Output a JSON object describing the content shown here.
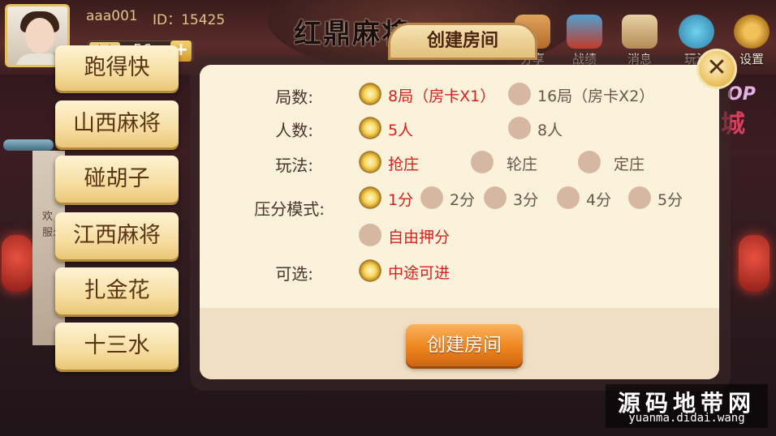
{
  "header": {
    "username": "aaa001",
    "user_id": "ID：15425",
    "card_label": "房卡",
    "card_count": "56",
    "card_add": "+",
    "logo_text": "红鼎麻将"
  },
  "top_nav": [
    {
      "label": "分享",
      "icon": "share-icon"
    },
    {
      "label": "战绩",
      "icon": "record-icon"
    },
    {
      "label": "消息",
      "icon": "message-icon"
    },
    {
      "label": "玩法",
      "icon": "rules-icon"
    },
    {
      "label": "设置",
      "icon": "gear-icon"
    }
  ],
  "side_text": {
    "shop_en": "OP",
    "shop_cn": "城",
    "scroll_text": "欢服:"
  },
  "game_list": [
    "跑得快",
    "山西麻将",
    "碰胡子",
    "江西麻将",
    "扎金花",
    "十三水"
  ],
  "modal": {
    "title": "创建房间",
    "close_label": "✕",
    "rows": {
      "rounds": {
        "label": "局数:",
        "options": [
          {
            "text": "8局（房卡X1）",
            "selected": true
          },
          {
            "text": "16局（房卡X2）",
            "selected": false
          }
        ]
      },
      "players": {
        "label": "人数:",
        "options": [
          {
            "text": "5人",
            "selected": true
          },
          {
            "text": "8人",
            "selected": false
          }
        ]
      },
      "mode": {
        "label": "玩法:",
        "options": [
          {
            "text": "抢庄",
            "selected": true
          },
          {
            "text": "轮庄",
            "selected": false
          },
          {
            "text": "定庄",
            "selected": false
          }
        ]
      },
      "bet": {
        "label": "压分模式:",
        "options": [
          {
            "text": "1分",
            "selected": true
          },
          {
            "text": "2分",
            "selected": false
          },
          {
            "text": "3分",
            "selected": false
          },
          {
            "text": "4分",
            "selected": false
          },
          {
            "text": "5分",
            "selected": false
          },
          {
            "text": "自由押分",
            "selected": false
          }
        ]
      },
      "optional": {
        "label": "可选:",
        "options": [
          {
            "text": "中途可进",
            "selected": true
          }
        ]
      }
    },
    "create_button": "创建房间"
  },
  "watermark": {
    "cn": "源码地带网",
    "en": "yuanma.didai.wang"
  }
}
